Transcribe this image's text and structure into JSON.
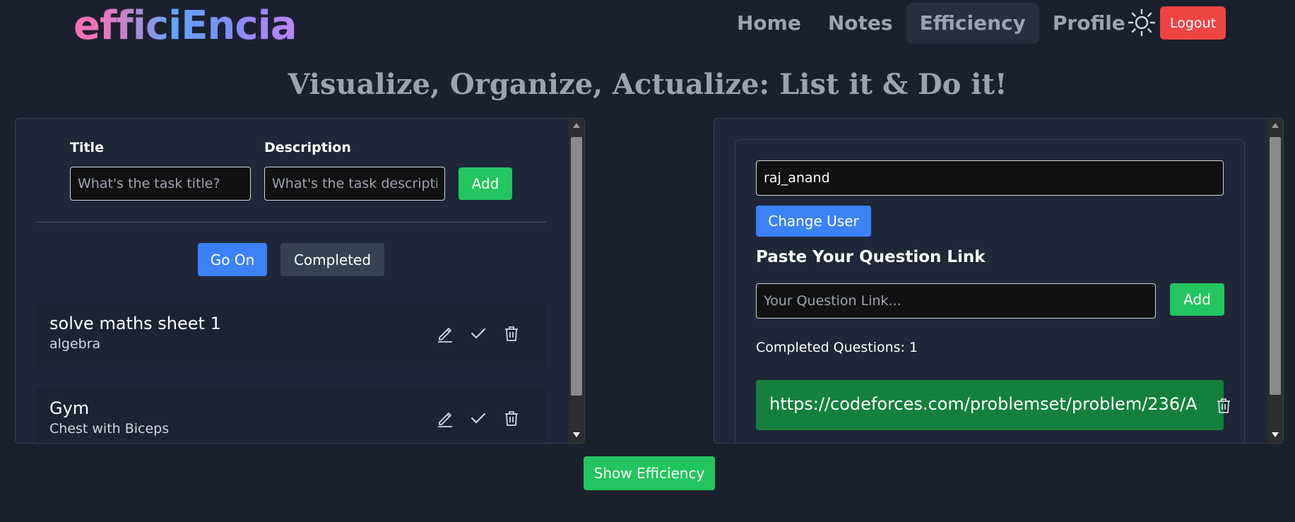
{
  "header": {
    "logo": "efficiEncia",
    "nav": [
      "Home",
      "Notes",
      "Efficiency",
      "Profile"
    ],
    "active_nav": "Efficiency",
    "theme_icon": "sun-icon",
    "logout_label": "Logout"
  },
  "headline": "Visualize, Organize, Actualize: List it & Do it!",
  "tasks_panel": {
    "title_label": "Title",
    "description_label": "Description",
    "title_placeholder": "What's the task title?",
    "description_placeholder": "What's the task description?",
    "add_label": "Add",
    "tabs": [
      "Go On",
      "Completed"
    ],
    "active_tab": "Go On",
    "tasks": [
      {
        "title": "solve maths sheet 1",
        "description": "algebra"
      },
      {
        "title": "Gym",
        "description": "Chest with Biceps"
      }
    ],
    "icons": [
      "edit-icon",
      "check-icon",
      "trash-icon"
    ]
  },
  "questions_panel": {
    "username_value": "raj_anand",
    "change_user_label": "Change User",
    "section_title": "Paste Your Question Link",
    "link_placeholder": "Your Question Link...",
    "add_label": "Add",
    "completed_text": "Completed Questions: 1",
    "links": [
      "https://codeforces.com/problemset/problem/236/A"
    ]
  },
  "footer": {
    "show_efficiency_label": "Show Efficiency"
  },
  "colors": {
    "background": "#1b212c",
    "panel": "#1f2738",
    "green": "#22c55e",
    "blue": "#3b82f6",
    "red": "#ef4444",
    "link_bg": "#15803d"
  }
}
